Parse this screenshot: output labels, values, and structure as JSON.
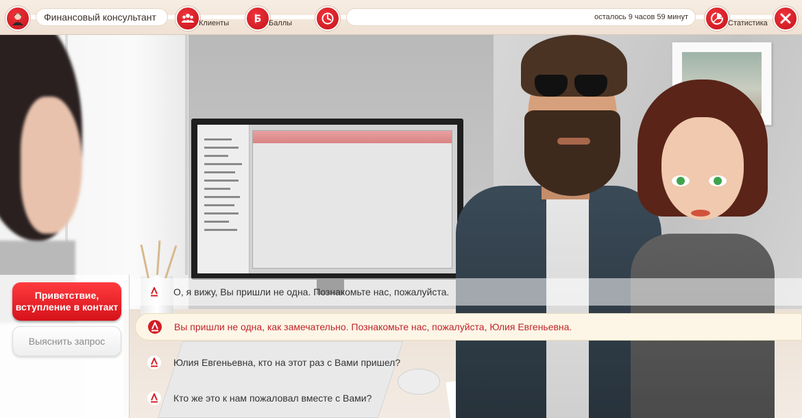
{
  "topbar": {
    "role_title": "Финансовый консультант",
    "clients_label": "Клиенты",
    "points_label": "Баллы",
    "timer_text": "осталось 9 часов 59 минут",
    "stats_label": "Статистика"
  },
  "stages": {
    "active": "Приветствие, вступление в контакт",
    "next": "Выяснить запрос"
  },
  "answers": [
    {
      "text": "О, я вижу, Вы пришли не одна. Познакомьте нас, пожалуйста."
    },
    {
      "text": "Вы пришли не одна, как замечательно. Познакомьте нас, пожалуйста, Юлия Евгеньевна."
    },
    {
      "text": "Юлия Евгеньевна, кто на этот раз с Вами пришел?"
    },
    {
      "text": "Кто же это к нам пожаловал вместе с Вами?"
    }
  ],
  "colors": {
    "brand_red": "#d5121a",
    "highlight_bg": "#fdf6e6",
    "highlight_text": "#c0242b"
  },
  "icons": [
    "consultant-avatar-icon",
    "clients-icon",
    "points-icon",
    "timer-icon",
    "statistics-icon",
    "close-icon",
    "alfa-logo-icon"
  ]
}
